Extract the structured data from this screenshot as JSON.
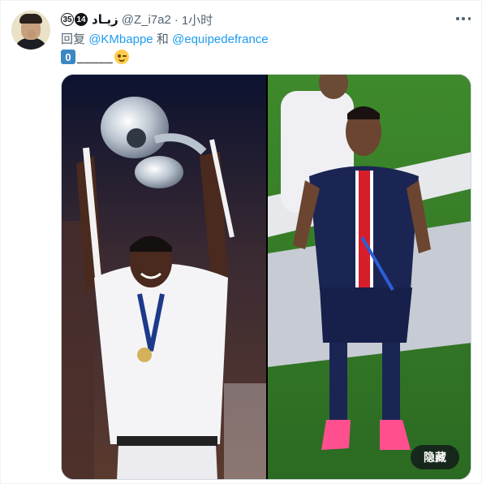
{
  "tweet": {
    "badges": [
      "35",
      "14"
    ],
    "display_name": "زيـاد",
    "handle": "@Z_i7a2",
    "separator": "·",
    "time": "1小时",
    "reply_prefix": "回复",
    "mentions": [
      "@KMbappe",
      "@equipedefrance"
    ],
    "reply_joiner": "和",
    "zero_key": "0",
    "text_after": "_____",
    "emoji_icon": "winking-face-icon",
    "media_button_label": "隐藏"
  },
  "colors": {
    "link": "#1d9bf0",
    "secondary_text": "#536471",
    "psg_navy": "#1b2554",
    "pitch_green": "#2e7a2a"
  }
}
